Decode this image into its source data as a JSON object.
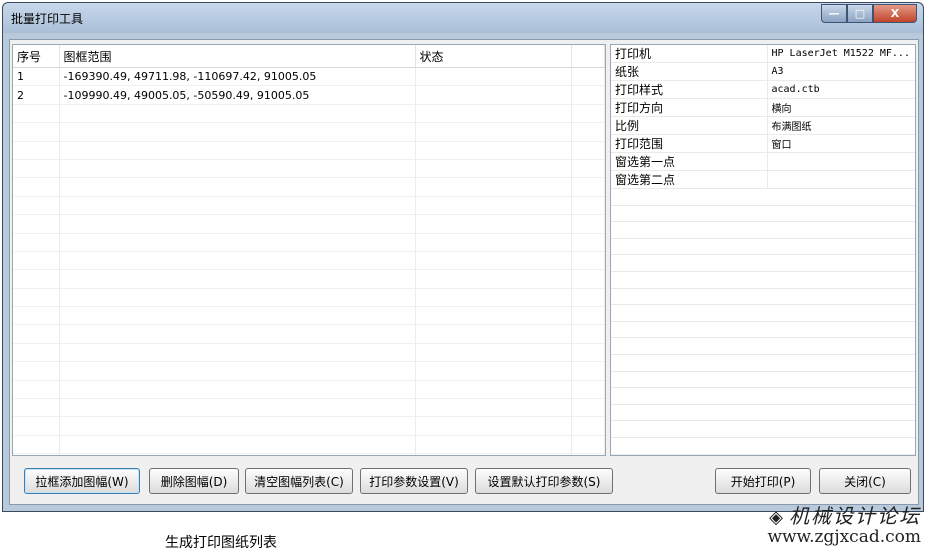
{
  "window": {
    "title": "批量打印工具",
    "min_glyph": "—",
    "max_glyph": "□",
    "close_glyph": "X"
  },
  "list": {
    "headers": [
      "序号",
      "图框范围",
      "状态"
    ],
    "rows": [
      {
        "index": "1",
        "range": "-169390.49, 49711.98, -110697.42, 91005.05",
        "status": ""
      },
      {
        "index": "2",
        "range": "-109990.49, 49005.05, -50590.49, 91005.05",
        "status": ""
      }
    ]
  },
  "properties": [
    {
      "label": "打印机",
      "value": "HP LaserJet M1522 MF..."
    },
    {
      "label": "纸张",
      "value": "A3"
    },
    {
      "label": "打印样式",
      "value": "acad.ctb"
    },
    {
      "label": "打印方向",
      "value": "横向"
    },
    {
      "label": "比例",
      "value": "布满图纸"
    },
    {
      "label": "打印范围",
      "value": "窗口"
    },
    {
      "label": "窗选第一点",
      "value": ""
    },
    {
      "label": "窗选第二点",
      "value": ""
    }
  ],
  "buttons": {
    "add_by_box": "拉框添加图幅(W)",
    "delete": "删除图幅(D)",
    "clear": "清空图幅列表(C)",
    "print_settings": "打印参数设置(V)",
    "set_default": "设置默认打印参数(S)",
    "start_print": "开始打印(P)",
    "close": "关闭(C)"
  },
  "caption": "生成打印图纸列表",
  "watermark": {
    "cn": "机械设计论坛",
    "url": "www.zgjxcad.com"
  }
}
